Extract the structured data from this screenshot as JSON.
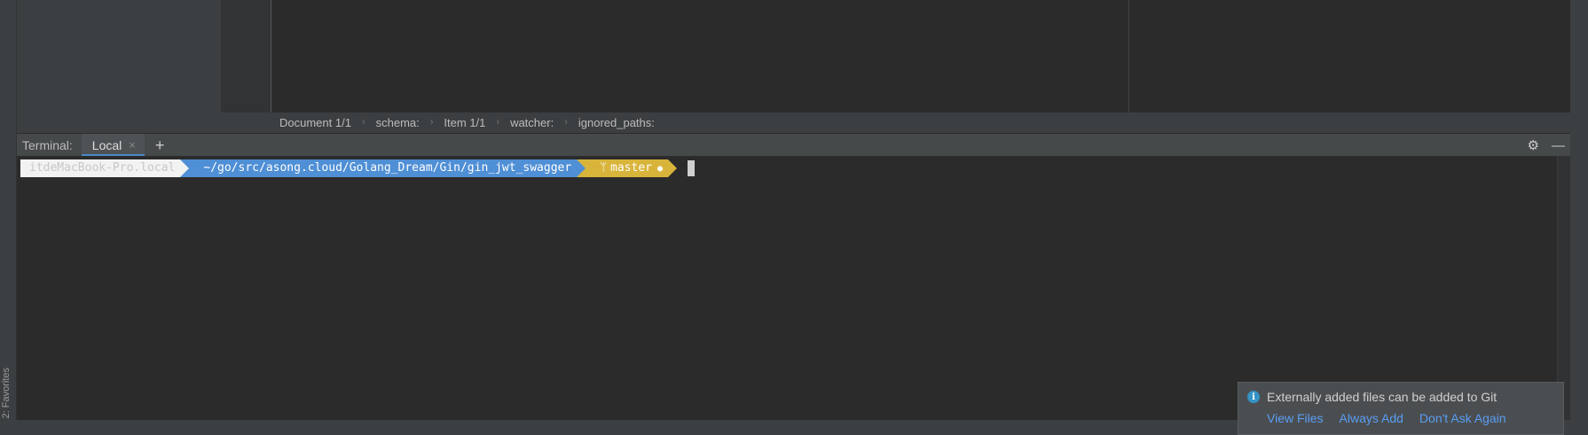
{
  "sidebar": {
    "favorites_label": "2: Favorites"
  },
  "breadcrumb": {
    "items": [
      "Document 1/1",
      "schema:",
      "Item 1/1",
      "watcher:",
      "ignored_paths:"
    ]
  },
  "terminal": {
    "title": "Terminal:",
    "tab_label": "Local",
    "close_glyph": "×",
    "add_glyph": "+",
    "settings_glyph": "⚙",
    "hide_glyph": "—",
    "prompt": {
      "host": "itdeMacBook-Pro.local",
      "path": "~/go/src/asong.cloud/Golang_Dream/Gin/gin_jwt_swagger",
      "branch_glyph": "ᛘ",
      "branch": "master",
      "dirty_glyph": "●"
    }
  },
  "notification": {
    "icon_glyph": "i",
    "message": "Externally added files can be added to Git",
    "actions": [
      "View Files",
      "Always Add",
      "Don't Ask Again"
    ]
  },
  "colors": {
    "path_segment": "#4f8fd5",
    "git_segment": "#d8b43a",
    "host_segment": "#f2f2f2",
    "link": "#589df6",
    "tab_underline": "#4a88c7"
  }
}
